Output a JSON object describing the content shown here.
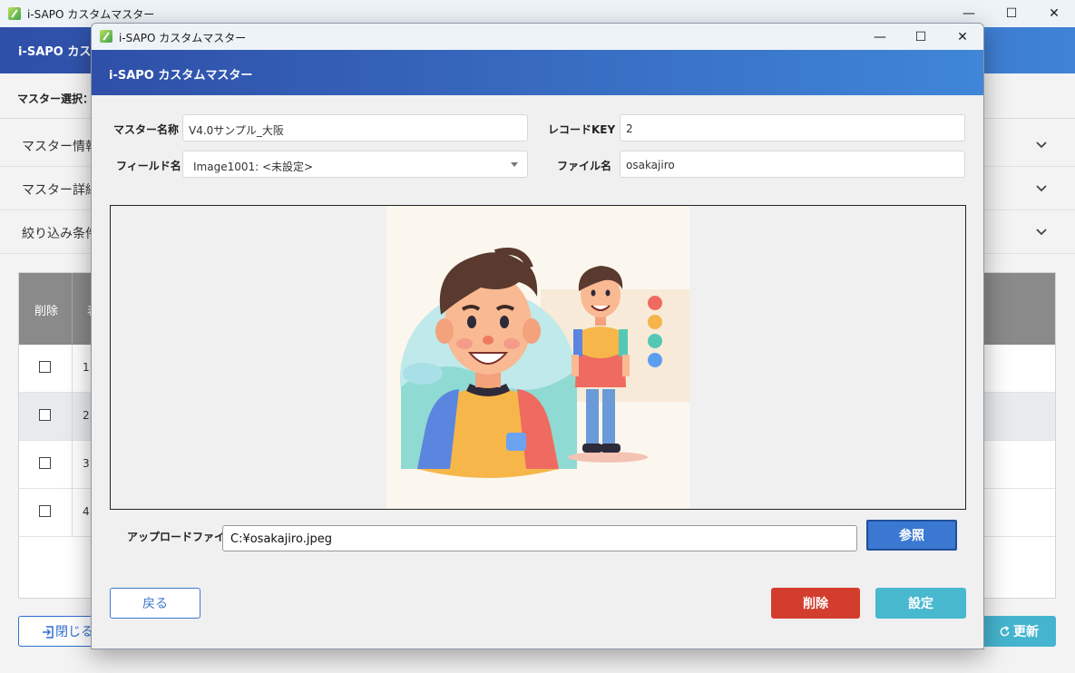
{
  "background_window": {
    "title": "i-SAPO カスタムマスター",
    "header_title": "i-SAPO カスタムマスター",
    "master_select_label": "マスター選択：",
    "accordions": [
      {
        "label": "マスター情報"
      },
      {
        "label": "マスター詳細"
      },
      {
        "label": "絞り込み条件"
      }
    ],
    "table": {
      "col_delete": "削除",
      "col_second": "表",
      "rows": [
        "1",
        "2",
        "3",
        "4"
      ]
    },
    "close_button": "閉じる",
    "refresh_button": "更新",
    "close_button_icon": "exit-icon",
    "refresh_button_icon": "refresh-icon"
  },
  "dialog": {
    "title": "i-SAPO カスタムマスター",
    "header_title": "i-SAPO カスタムマスター",
    "form": {
      "master_name_label": "マスター名称",
      "master_name_value": "V4.0サンプル_大阪",
      "record_key_label": "レコードKEY",
      "record_key_value": "2",
      "field_name_label": "フィールド名",
      "field_name_value": "Image1001: <未設定>",
      "file_name_label": "ファイル名",
      "file_name_value": "osakajiro"
    },
    "upload_label": "アップロードファイル",
    "upload_path": "C:¥osakajiro.jpeg",
    "browse_button": "参照",
    "back_button": "戻る",
    "delete_button": "削除",
    "set_button": "設定"
  },
  "window_controls": {
    "minimize": "—",
    "maximize": "☐",
    "close": "✕"
  },
  "colors": {
    "header_gradient_start": "#2f4fa8",
    "header_gradient_end": "#3f86d8",
    "primary_blue": "#3a78d1",
    "danger_red": "#d33d2d",
    "accent_teal": "#48b8cf"
  }
}
